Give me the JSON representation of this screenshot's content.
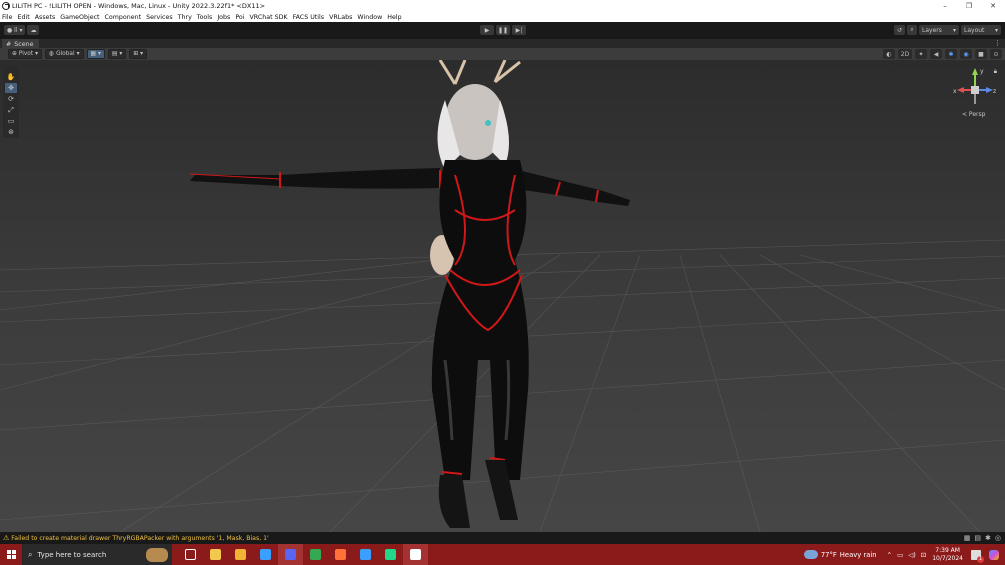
{
  "window": {
    "title": "LILITH PC - !LILITH OPEN - Windows, Mac, Linux - Unity 2022.3.22f1* <DX11>",
    "controls": [
      "–",
      "❐",
      "✕"
    ]
  },
  "menu": [
    "File",
    "Edit",
    "Assets",
    "GameObject",
    "Component",
    "Services",
    "Thry",
    "Tools",
    "Jobs",
    "Poi",
    "VRChat SDK",
    "FACS Utils",
    "VRLabs",
    "Window",
    "Help"
  ],
  "toolbar": {
    "account_label": "ll",
    "layers_label": "Layers",
    "layout_label": "Layout"
  },
  "scene": {
    "tab_label": "Scene",
    "pivot_label": "Pivot",
    "global_label": "Global",
    "mode_2d_label": "2D",
    "persp_label": "< Persp",
    "gizmo_axes": {
      "x": "x",
      "z": "z",
      "y": "y"
    }
  },
  "status": {
    "message": "Failed to create material drawer ThryRGBAPacker with arguments '1, Mask, Bias, 1'"
  },
  "taskbar": {
    "search_placeholder": "Type here to search",
    "weather_temp": "77°F",
    "weather_desc": "Heavy rain",
    "time": "7:39 AM",
    "date": "10/7/2024",
    "notification_count": "1",
    "pinned_apps": [
      {
        "name": "task-view",
        "color": "#ffffff"
      },
      {
        "name": "microsoft-store",
        "color": "#f2c94c"
      },
      {
        "name": "file-explorer",
        "color": "#f2b233"
      },
      {
        "name": "code-editor",
        "color": "#3aa0ff"
      },
      {
        "name": "chat-app",
        "color": "#5865f2"
      },
      {
        "name": "chrome",
        "color": "#34a853"
      },
      {
        "name": "firefox",
        "color": "#ff7139"
      },
      {
        "name": "code-editor-2",
        "color": "#3aa0ff"
      },
      {
        "name": "pycharm",
        "color": "#21d789"
      },
      {
        "name": "unity-hub",
        "color": "#ffffff"
      }
    ]
  },
  "colors": {
    "accent": "#46607c",
    "taskbar": "#8b1a1a",
    "warning": "#f0c040"
  }
}
